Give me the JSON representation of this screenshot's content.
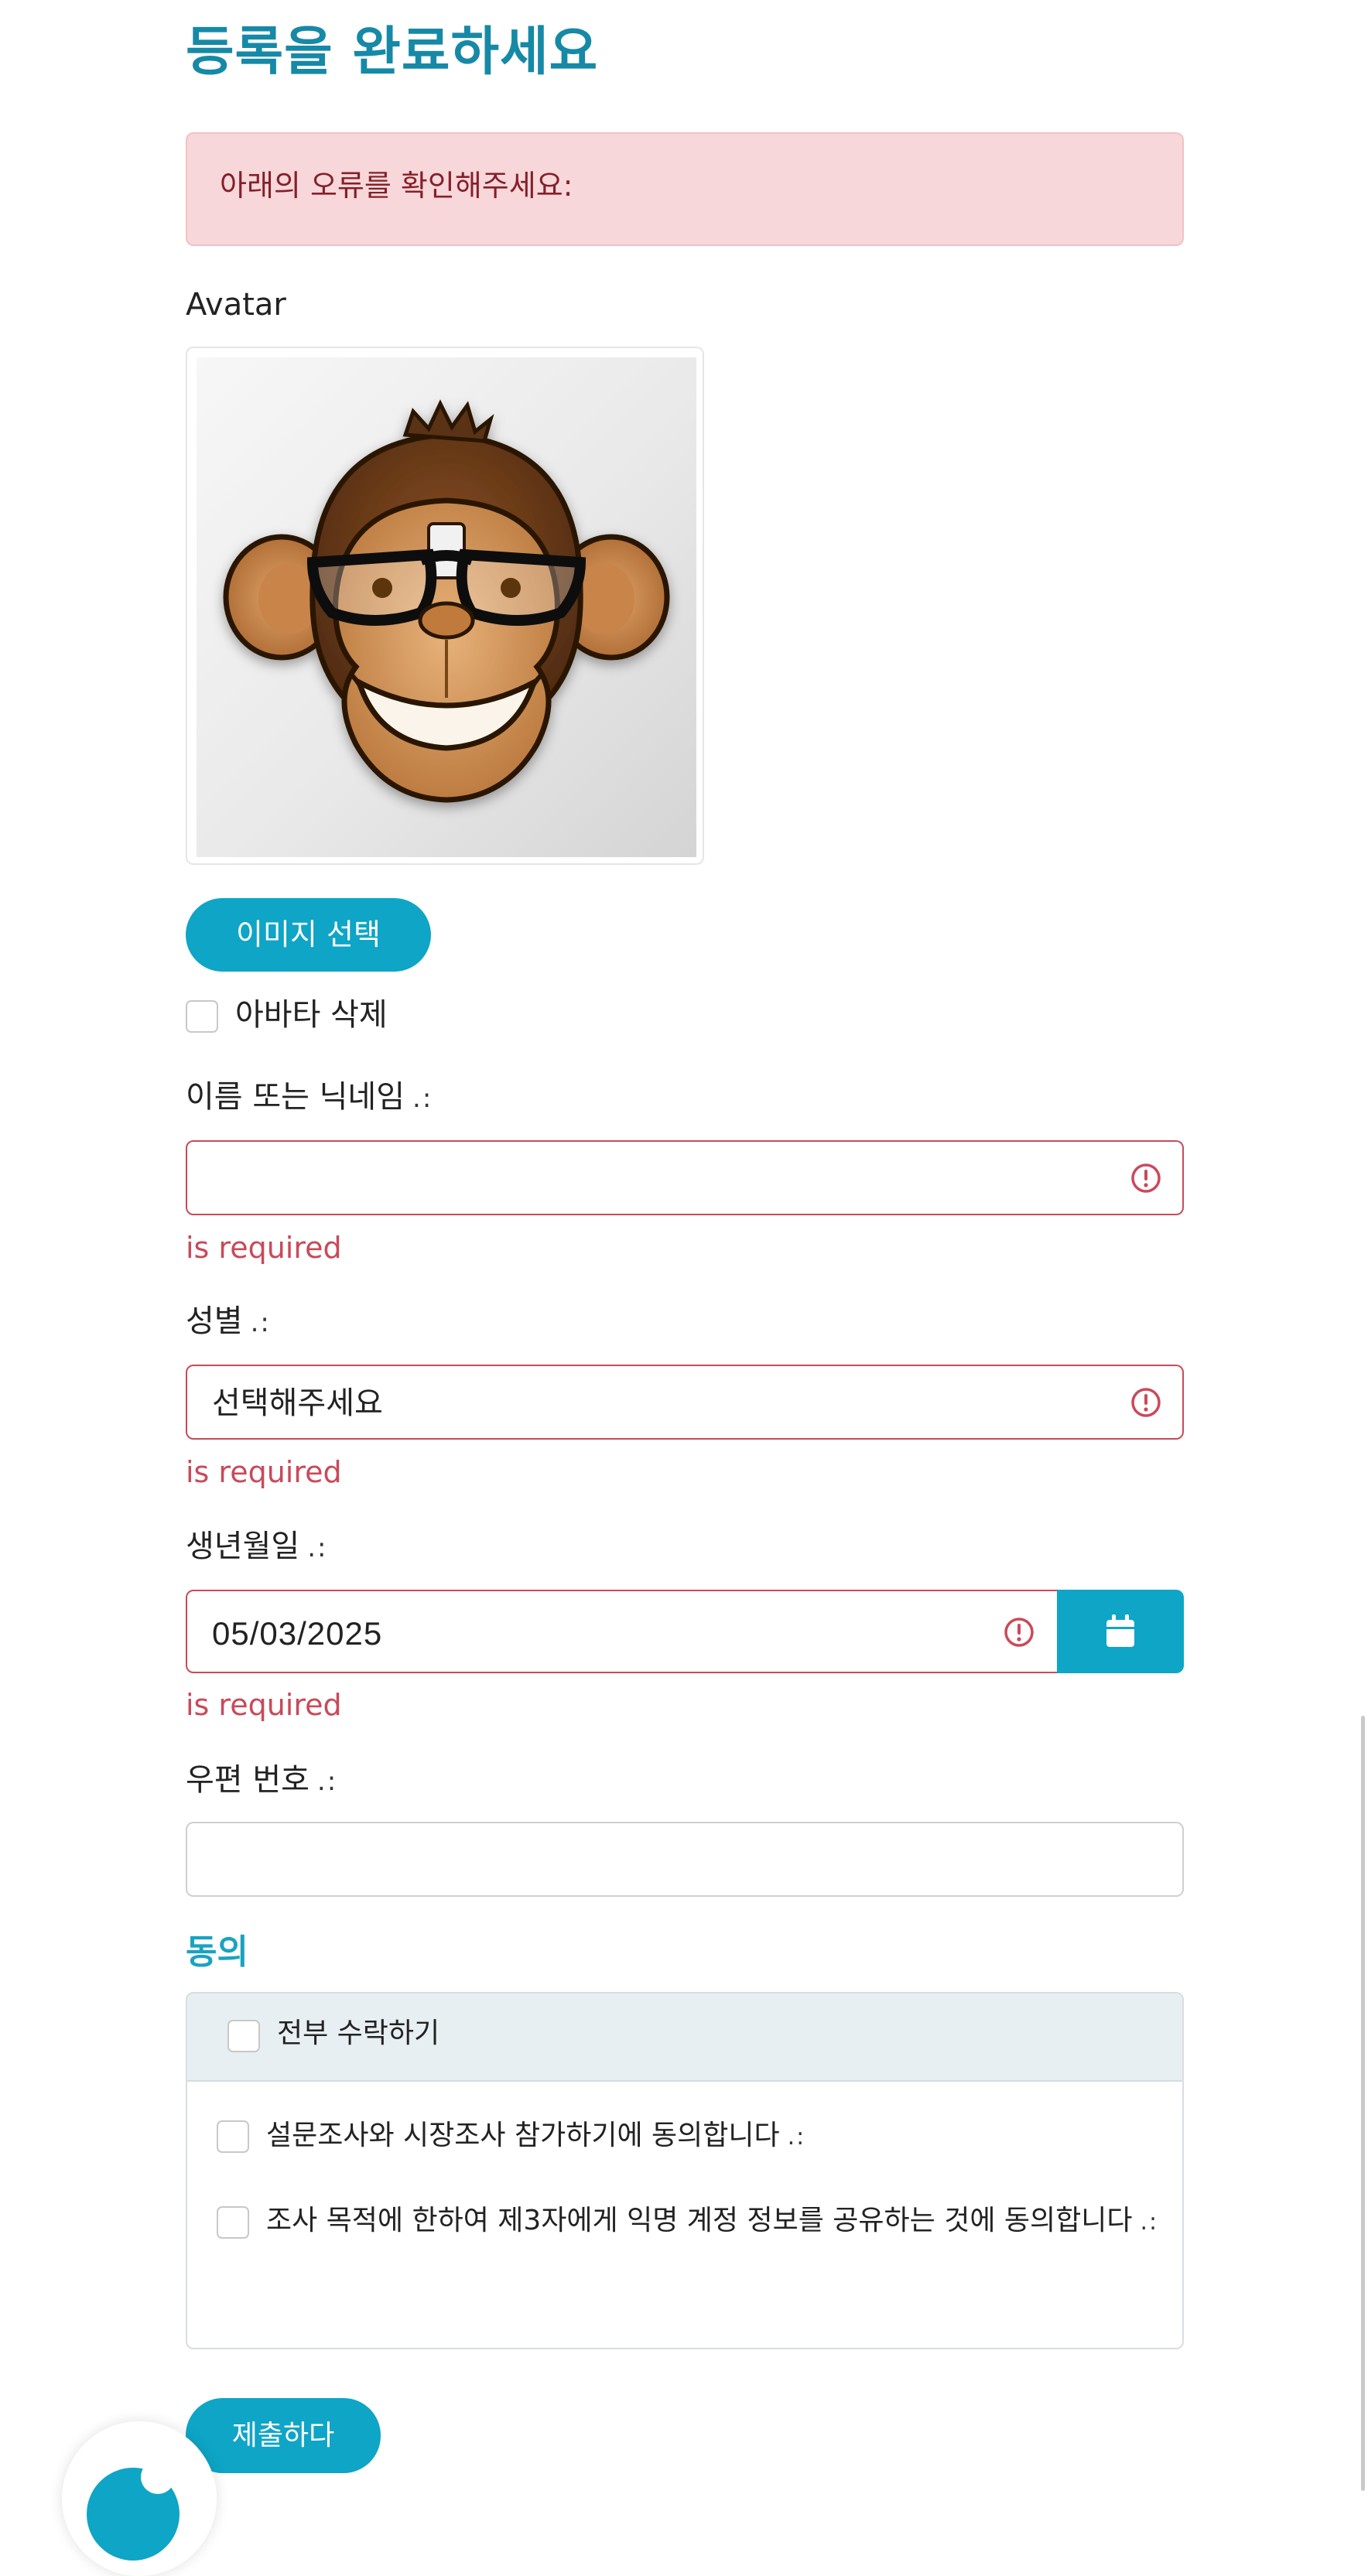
{
  "page": {
    "title": "등록을 완료하세요"
  },
  "alert": {
    "message": "아래의 오류를 확인해주세요:"
  },
  "avatar": {
    "label": "Avatar",
    "choose_button": "이미지 선택",
    "delete_label": "아바타 삭제"
  },
  "fields": {
    "name": {
      "label": "이름 또는 닉네임",
      "required_mark": ".:",
      "value": "",
      "error": "is required"
    },
    "gender": {
      "label": "성별",
      "required_mark": ".:",
      "value": "선택해주세요",
      "error": "is required"
    },
    "birthdate": {
      "label": "생년월일",
      "required_mark": ".:",
      "value": "05/03/2025",
      "error": "is required"
    },
    "postal_code": {
      "label": "우편 번호",
      "required_mark": ".:",
      "value": ""
    }
  },
  "consent": {
    "title": "동의",
    "accept_all": "전부 수락하기",
    "items": [
      {
        "label": "설문조사와 시장조사 참가하기에 동의합니다",
        "required_mark": ".:"
      },
      {
        "label": "조사 목적에 한하여 제3자에게 익명 계정 정보를 공유하는 것에 동의합니다",
        "required_mark": ".:"
      }
    ]
  },
  "submit": {
    "label": "제출하다"
  },
  "colors": {
    "brand": "#0ea5c6",
    "title": "#1689a6",
    "error": "#c94a5a",
    "alert_bg": "#f8d7da",
    "alert_text": "#842029"
  },
  "icons": {
    "field_error": "exclamation-circle-icon",
    "date_picker": "calendar-icon"
  }
}
